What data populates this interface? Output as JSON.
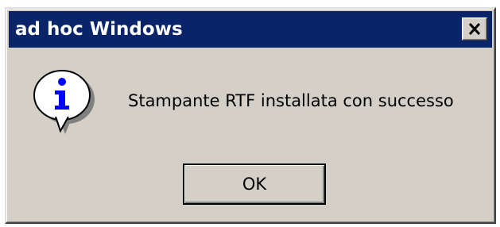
{
  "window": {
    "title": "ad hoc Windows",
    "close_icon": "close-icon"
  },
  "dialog": {
    "icon": "information-icon",
    "message": "Stampante RTF installata con successo",
    "ok_label": "OK"
  },
  "colors": {
    "titlebar": "#0a246a",
    "face": "#d4d0c8",
    "icon_accent": "#0000ff"
  }
}
